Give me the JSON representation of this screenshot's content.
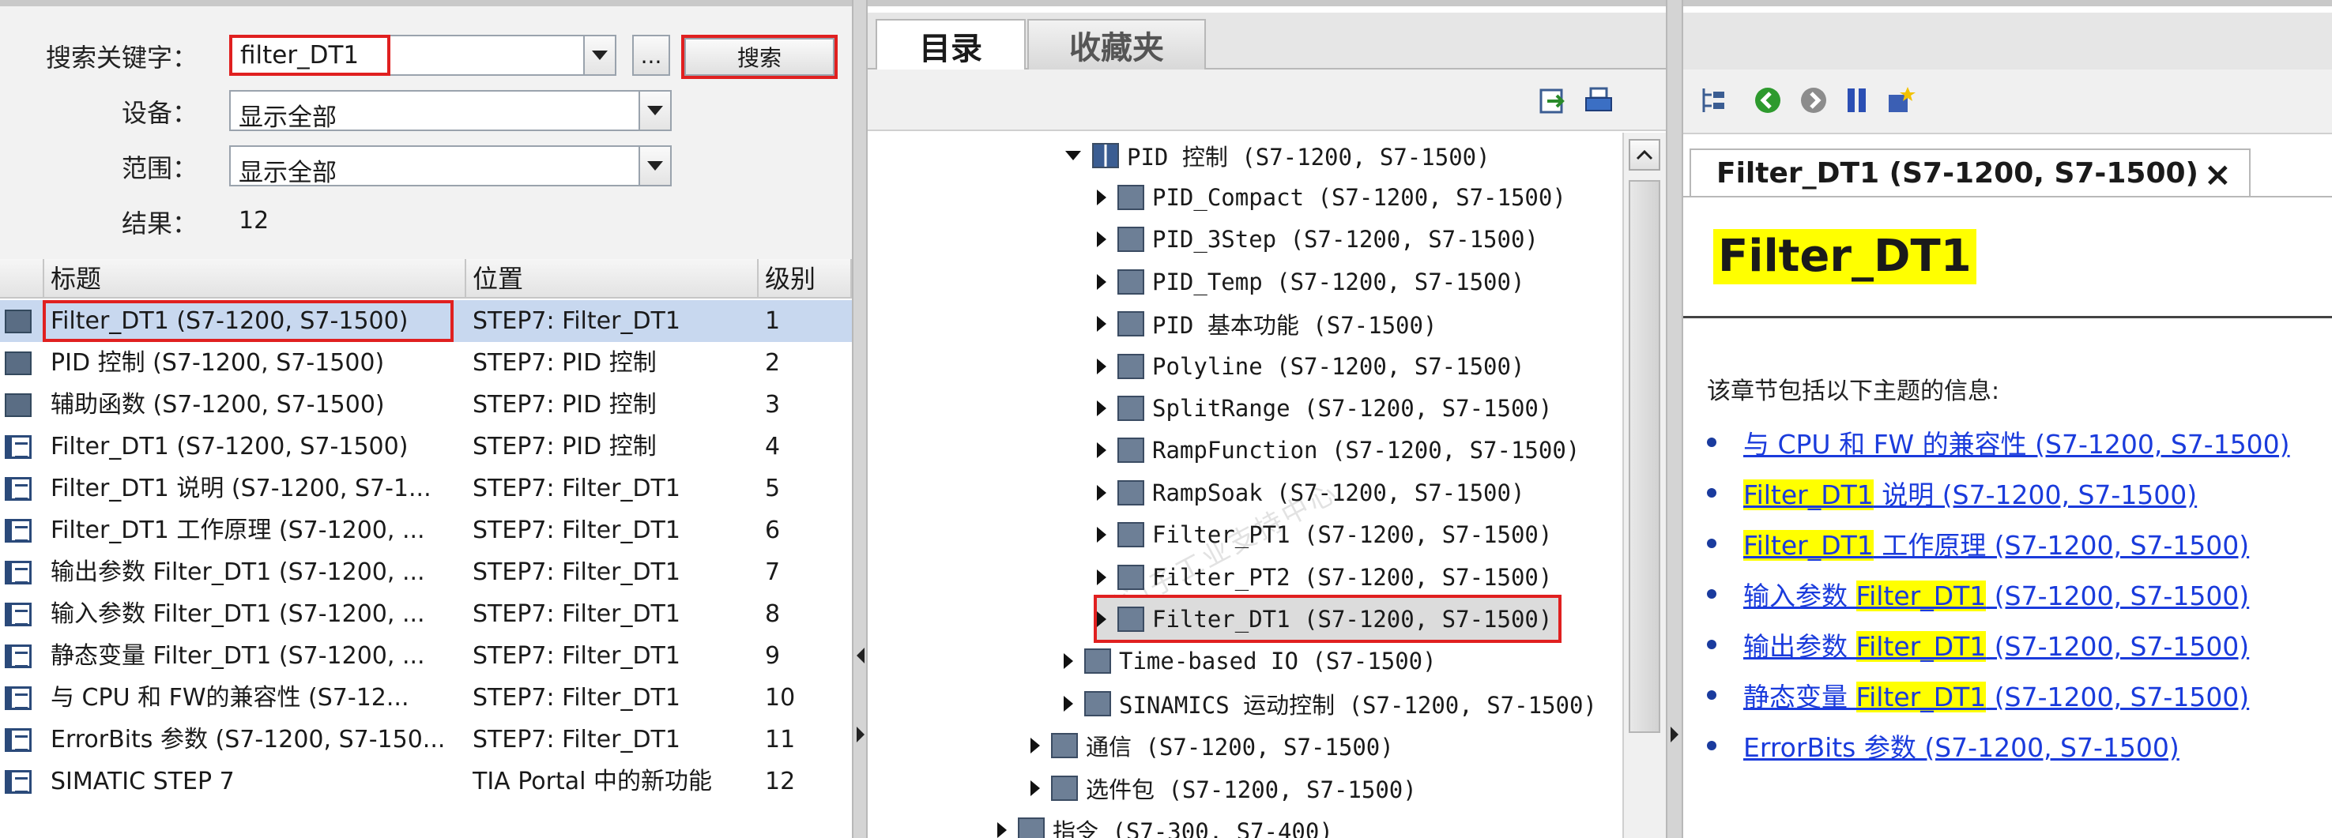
{
  "search": {
    "keyword_label": "搜索关键字：",
    "keyword_value": "filter_DT1",
    "more_label": "...",
    "search_button": "搜索",
    "device_label": "设备：",
    "device_value": "显示全部",
    "scope_label": "范围：",
    "scope_value": "显示全部",
    "result_label": "结果：",
    "result_count": "12"
  },
  "results": {
    "headers": [
      "标题",
      "位置",
      "级别"
    ],
    "rows": [
      {
        "icon": "book-icon",
        "title": "Filter_DT1 (S7-1200, S7-1500)",
        "location": "STEP7: Filter_DT1",
        "level": "1",
        "selected": true
      },
      {
        "icon": "book-icon",
        "title": "PID 控制 (S7-1200, S7-1500)",
        "location": "STEP7: PID 控制",
        "level": "2"
      },
      {
        "icon": "book-icon",
        "title": "辅助函数 (S7-1200, S7-1500)",
        "location": "STEP7: PID 控制",
        "level": "3"
      },
      {
        "icon": "page-icon",
        "title": "Filter_DT1 (S7-1200, S7-1500)",
        "location": "STEP7: PID 控制",
        "level": "4"
      },
      {
        "icon": "page-icon",
        "title": "Filter_DT1 说明 (S7-1200, S7-1...",
        "location": "STEP7: Filter_DT1",
        "level": "5"
      },
      {
        "icon": "page-icon",
        "title": "Filter_DT1 工作原理 (S7-1200, ...",
        "location": "STEP7: Filter_DT1",
        "level": "6"
      },
      {
        "icon": "page-icon",
        "title": "输出参数 Filter_DT1 (S7-1200, ...",
        "location": "STEP7: Filter_DT1",
        "level": "7"
      },
      {
        "icon": "page-icon",
        "title": "输入参数 Filter_DT1 (S7-1200, ...",
        "location": "STEP7: Filter_DT1",
        "level": "8"
      },
      {
        "icon": "page-icon",
        "title": "静态变量 Filter_DT1 (S7-1200, ...",
        "location": "STEP7: Filter_DT1",
        "level": "9"
      },
      {
        "icon": "page-icon",
        "title": "与 CPU 和 FW的兼容性 (S7-12...",
        "location": "STEP7: Filter_DT1",
        "level": "10"
      },
      {
        "icon": "page-icon",
        "title": "ErrorBits 参数 (S7-1200, S7-150...",
        "location": "STEP7: Filter_DT1",
        "level": "11"
      },
      {
        "icon": "page-icon",
        "title": "SIMATIC STEP 7",
        "location": "TIA Portal 中的新功能",
        "level": "12"
      }
    ]
  },
  "catalog": {
    "tabs": [
      "目录",
      "收藏夹"
    ],
    "tree": [
      {
        "label": "PID 控制 (S7-1200, S7-1500)",
        "open": true,
        "book": true
      },
      {
        "label": "PID_Compact (S7-1200, S7-1500)"
      },
      {
        "label": "PID_3Step (S7-1200, S7-1500)"
      },
      {
        "label": "PID_Temp (S7-1200, S7-1500)"
      },
      {
        "label": "PID 基本功能 (S7-1500)"
      },
      {
        "label": "Polyline (S7-1200, S7-1500)"
      },
      {
        "label": "SplitRange (S7-1200, S7-1500)"
      },
      {
        "label": "RampFunction (S7-1200, S7-1500)"
      },
      {
        "label": "RampSoak (S7-1200, S7-1500)"
      },
      {
        "label": "Filter_PT1 (S7-1200, S7-1500)"
      },
      {
        "label": "Filter_PT2 (S7-1200, S7-1500)"
      },
      {
        "label": "Filter_DT1 (S7-1200, S7-1500)",
        "selected": true
      },
      {
        "label": "Time-based IO (S7-1500)"
      },
      {
        "label": "SINAMICS 运动控制 (S7-1200, S7-1500)"
      },
      {
        "label": "通信 (S7-1200, S7-1500)"
      },
      {
        "label": "选件包 (S7-1200, S7-1500)"
      },
      {
        "label": "指令 (S7-300, S7-400)"
      }
    ]
  },
  "help": {
    "tab_title": "Filter_DT1 (S7-1200, S7-1500)",
    "close_label": "×",
    "doc_title": "Filter_DT1",
    "intro": "该章节包括以下主题的信息:",
    "links": [
      {
        "pre": "",
        "hl": "",
        "post": "与 CPU 和 FW 的兼容性 (S7-1200, S7-1500)"
      },
      {
        "pre": "",
        "hl": "Filter_DT1",
        "post": " 说明 (S7-1200, S7-1500)"
      },
      {
        "pre": "",
        "hl": "Filter_DT1",
        "post": " 工作原理 (S7-1200, S7-1500)"
      },
      {
        "pre": "输入参数 ",
        "hl": "Filter_DT1",
        "post": " (S7-1200, S7-1500)"
      },
      {
        "pre": "输出参数 ",
        "hl": "Filter_DT1",
        "post": " (S7-1200, S7-1500)"
      },
      {
        "pre": "静态变量 ",
        "hl": "Filter_DT1",
        "post": " (S7-1200, S7-1500)"
      },
      {
        "pre": "",
        "hl": "",
        "post": "ErrorBits 参数 (S7-1200, S7-1500)"
      }
    ]
  },
  "colors": {
    "highlight": "#ffff00",
    "link": "#1a3bdc",
    "red_frame": "#e02020",
    "selection": "#c8d8ef"
  }
}
